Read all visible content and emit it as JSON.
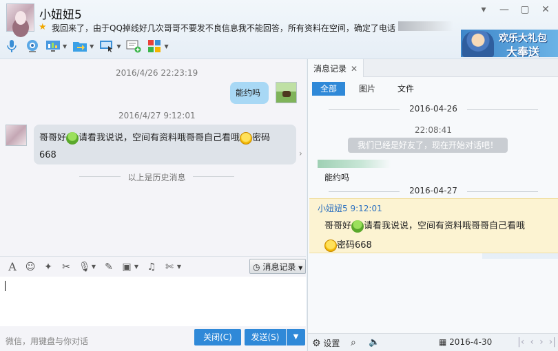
{
  "header": {
    "contact_name": "小妞妞5",
    "signature": "我回来了，由于QQ掉线好几次哥哥不要发不良信息我不能回答，所有资料在空间，确定了电话",
    "window_controls": {
      "minimize": "—",
      "maximize": "▢",
      "close": "✕",
      "dropdown": "▾"
    },
    "toolbar_icons": [
      "microphone-icon",
      "camera-icon",
      "screen-share-icon",
      "file-transfer-icon",
      "remote-desktop-icon",
      "share-screen-add-icon",
      "apps-grid-icon"
    ],
    "ad": {
      "line1": "欢乐大礼包",
      "line2": "大奉送"
    }
  },
  "chat": {
    "messages": [
      {
        "time": "2016/4/26 22:23:19",
        "direction": "out",
        "text": "能约吗"
      },
      {
        "time": "2016/4/27 9:12:01",
        "direction": "in",
        "text_a": "哥哥好",
        "text_b": "请看我说说，空间有资料哦哥哥自己看哦",
        "text_c": "密码",
        "text_d": "668"
      }
    ],
    "history_divider": "以上是历史消息"
  },
  "input_toolbar": {
    "icons": [
      "font-icon",
      "emoji-icon",
      "magic-icon",
      "screenshot-icon",
      "voice-icon",
      "edit-icon",
      "image-icon",
      "music-icon",
      "scissors-icon"
    ],
    "history_button": "消息记录"
  },
  "footer": {
    "hint": "微信，用键盘与你对话",
    "close_button": "关闭(C)",
    "send_button": "发送(S)"
  },
  "history_panel": {
    "tab_label": "消息记录",
    "filters": [
      "全部",
      "图片",
      "文件"
    ],
    "date1": "2016-04-26",
    "sys_time": "22:08:41",
    "sys_msg": "我们已经是好友了，现在开始对话吧！",
    "msg1": "能约吗",
    "date2": "2016-04-27",
    "highlight": {
      "sender": "小妞妞5 9:12:01",
      "text_a": "哥哥好",
      "text_b": "请看我说说，空间有资料哦哥哥自己看哦",
      "text_c": "密码668"
    },
    "footer": {
      "settings": "设置",
      "date": "2016-4-30"
    }
  },
  "colors": {
    "accent": "#2f89d8",
    "bubble_out": "#a8d8f5",
    "bubble_in": "#dee3e9",
    "highlight": "#fcf3d2"
  }
}
